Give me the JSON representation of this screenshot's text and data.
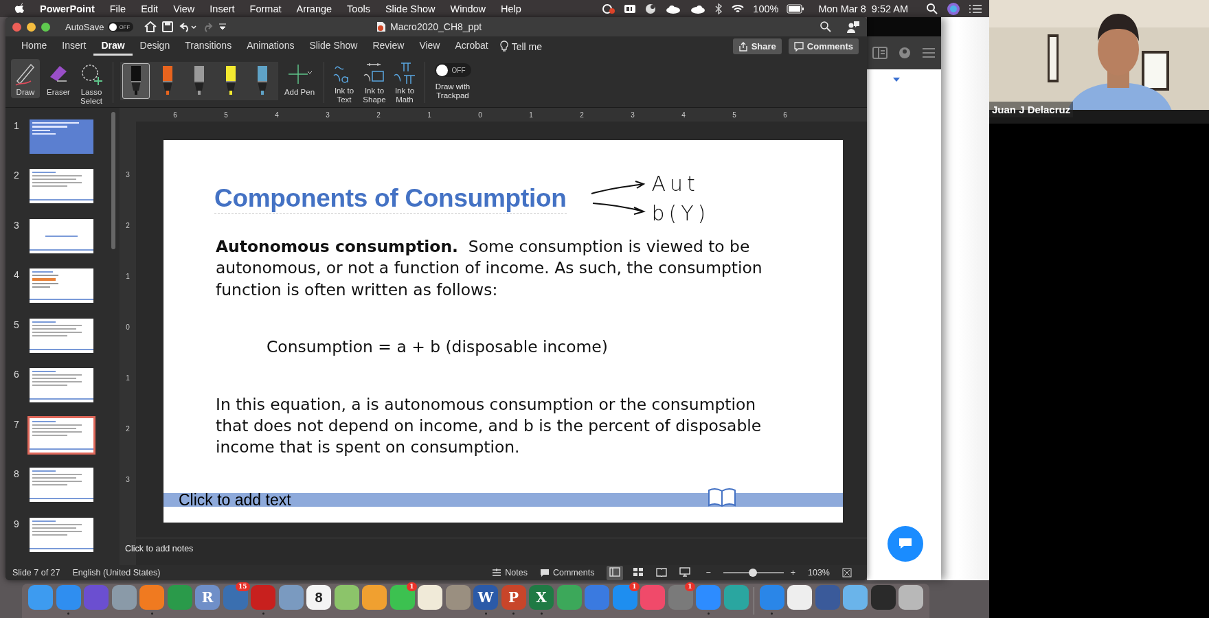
{
  "menu_bar": {
    "app": "PowerPoint",
    "menus": [
      "File",
      "Edit",
      "View",
      "Insert",
      "Format",
      "Arrange",
      "Tools",
      "Slide Show",
      "Window",
      "Help"
    ],
    "battery": "100%",
    "clock": "Mon Mar 8  9:52 AM"
  },
  "window": {
    "title": "Macro2020_CH8_ppt",
    "autosave": {
      "label": "AutoSave",
      "toggle": "OFF",
      "on": false
    }
  },
  "tabs": [
    {
      "label": "Home",
      "selected": false
    },
    {
      "label": "Insert",
      "selected": false
    },
    {
      "label": "Draw",
      "selected": true
    },
    {
      "label": "Design",
      "selected": false
    },
    {
      "label": "Transitions",
      "selected": false
    },
    {
      "label": "Animations",
      "selected": false
    },
    {
      "label": "Slide Show",
      "selected": false
    },
    {
      "label": "Review",
      "selected": false
    },
    {
      "label": "View",
      "selected": false
    },
    {
      "label": "Acrobat",
      "selected": false
    }
  ],
  "tell_me": "Tell me",
  "share_button": "Share",
  "comments_button": "Comments",
  "ribbon": {
    "tools": [
      {
        "kind": "draw",
        "label": "Draw",
        "selected": true
      },
      {
        "kind": "eraser",
        "label": "Eraser",
        "selected": false
      },
      {
        "kind": "lasso",
        "label": "Lasso Select",
        "selected": false
      }
    ],
    "pens": [
      {
        "color": "#111111",
        "selected": true
      },
      {
        "color": "#e8641e",
        "selected": false
      },
      {
        "color": "#9a9a9a",
        "selected": false
      },
      {
        "color": "#f3e930",
        "selected": false
      },
      {
        "color": "#5fa3c7",
        "selected": false
      }
    ],
    "add_pen": "Add Pen",
    "ink": [
      {
        "kind": "text",
        "label": "Ink to Text"
      },
      {
        "kind": "shape",
        "label": "Ink to Shape"
      },
      {
        "kind": "math",
        "label": "Ink to Math"
      }
    ],
    "trackpad": {
      "toggle": "OFF",
      "on": false,
      "label": "Draw with Trackpad"
    }
  },
  "thumbnails": [
    {
      "number": "1",
      "kind": "title",
      "selected": false
    },
    {
      "number": "2",
      "kind": "content",
      "selected": false
    },
    {
      "number": "3",
      "kind": "section",
      "selected": false
    },
    {
      "number": "4",
      "kind": "diagram",
      "selected": false
    },
    {
      "number": "5",
      "kind": "content",
      "selected": false
    },
    {
      "number": "6",
      "kind": "content",
      "selected": false
    },
    {
      "number": "7",
      "kind": "content",
      "selected": true
    },
    {
      "number": "8",
      "kind": "content",
      "selected": false
    },
    {
      "number": "9",
      "kind": "content",
      "selected": false
    }
  ],
  "rulers": {
    "horizontal": [
      "6",
      "5",
      "4",
      "3",
      "2",
      "1",
      "0",
      "1",
      "2",
      "3",
      "4",
      "5",
      "6"
    ],
    "vertical": [
      "3",
      "2",
      "1",
      "0",
      "1",
      "2",
      "3"
    ]
  },
  "slide": {
    "title": "Components of Consumption",
    "ink": [
      "Aut",
      "b(Y)"
    ],
    "paragraphs": [
      {
        "kind": "text",
        "text": "**Autonomous consumption.**  Some consumption is viewed to be autonomous, or not a function of income. As such, the consumption function is often written as follows:"
      },
      {
        "kind": "equation",
        "text": "Consumption = a + b (disposable income)"
      },
      {
        "kind": "text",
        "text": "In this equation, a is autonomous consumption or the consumption that does not depend on income, and b is the percent of disposable income that is spent on consumption."
      }
    ],
    "footer": "Click to add text"
  },
  "notes_placeholder": "Click to add notes",
  "status_bar": {
    "slide": "Slide 7 of 27",
    "language": "English (United States)",
    "notes": "Notes",
    "comments": "Comments",
    "views": [
      {
        "kind": "normal",
        "selected": true
      },
      {
        "kind": "sorter",
        "selected": false
      },
      {
        "kind": "reading",
        "selected": false
      },
      {
        "kind": "show",
        "selected": false
      }
    ],
    "zoom": {
      "minus": "−",
      "plus": "+",
      "level": 0.49,
      "reading": "103%"
    }
  },
  "video": {
    "name": "Juan J Delacruz"
  },
  "dock": [
    {
      "kind": "messages",
      "color": "#3d9bf0",
      "running": false
    },
    {
      "kind": "finder",
      "color": "#2f8ef0",
      "running": true
    },
    {
      "kind": "siri",
      "color": "#6b4fd0",
      "running": false
    },
    {
      "kind": "rocket",
      "color": "#8a9aa8",
      "running": false
    },
    {
      "kind": "browser",
      "color": "#f07a20",
      "running": true
    },
    {
      "kind": "shapes",
      "color": "#2a9a4a",
      "running": false
    },
    {
      "kind": "letter",
      "color": "#6f8fc8",
      "glyph": "R",
      "running": false
    },
    {
      "kind": "grid",
      "color": "#3a6fb0",
      "badge": "15",
      "running": false
    },
    {
      "kind": "doc",
      "color": "#c8201e",
      "running": true
    },
    {
      "kind": "bird",
      "color": "#7a9ac0",
      "running": false
    },
    {
      "kind": "calendar",
      "color": "#f4f4f4",
      "glyph": "8",
      "running": false
    },
    {
      "kind": "map",
      "color": "#8cc46a",
      "running": false
    },
    {
      "kind": "flower",
      "color": "#f0a030",
      "running": false
    },
    {
      "kind": "chat",
      "color": "#3cc150",
      "badge": "1",
      "running": false
    },
    {
      "kind": "pen",
      "color": "#f0ead8",
      "running": false
    },
    {
      "kind": "notebook",
      "color": "#9a8f80",
      "running": false
    },
    {
      "kind": "letter",
      "color": "#2b5aa8",
      "glyph": "W",
      "running": true
    },
    {
      "kind": "letter",
      "color": "#c8452a",
      "glyph": "P",
      "running": true
    },
    {
      "kind": "letter",
      "color": "#1f7a44",
      "glyph": "X",
      "running": true
    },
    {
      "kind": "chart",
      "color": "#3ca85a",
      "running": false
    },
    {
      "kind": "lectern",
      "color": "#3a7ae0",
      "running": false
    },
    {
      "kind": "store",
      "color": "#1e8ef0",
      "badge": "1",
      "running": false
    },
    {
      "kind": "music",
      "color": "#f04a6a",
      "running": false
    },
    {
      "kind": "gear",
      "color": "#7a7a7a",
      "badge": "1",
      "running": false
    },
    {
      "kind": "camera",
      "color": "#2d8cff",
      "running": true
    },
    {
      "kind": "globe",
      "color": "#2aa6a0",
      "running": false
    },
    {
      "kind": "compass",
      "color": "#2a86e8",
      "running": true
    },
    {
      "kind": "page",
      "color": "#eeeeee",
      "running": false
    },
    {
      "kind": "screen",
      "color": "#3a5a9a",
      "running": false
    },
    {
      "kind": "folder",
      "color": "#6ab4ea",
      "running": false
    },
    {
      "kind": "screen",
      "color": "#2a2a2a",
      "running": false
    },
    {
      "kind": "trash",
      "color": "#b8b8b8",
      "running": false
    }
  ]
}
